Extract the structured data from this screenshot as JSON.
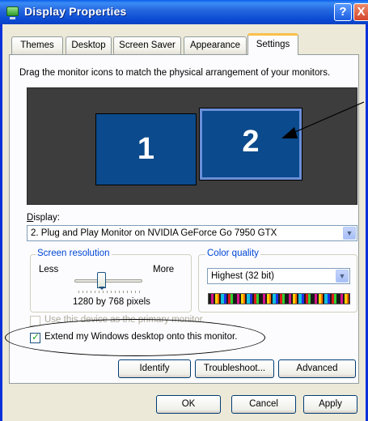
{
  "window": {
    "title": "Display Properties",
    "help": "?",
    "close": "X"
  },
  "tabs": [
    {
      "label": "Themes"
    },
    {
      "label": "Desktop"
    },
    {
      "label": "Screen Saver"
    },
    {
      "label": "Appearance"
    },
    {
      "label": "Settings"
    }
  ],
  "settings": {
    "instructions": "Drag the monitor icons to match the physical arrangement of your monitors.",
    "monitors": [
      {
        "label": "1"
      },
      {
        "label": "2"
      }
    ],
    "display_label": "Display:",
    "display_value": "2. Plug and Play Monitor on NVIDIA GeForce Go 7950 GTX",
    "resolution": {
      "group_title": "Screen resolution",
      "less": "Less",
      "more": "More",
      "value_text": "1280 by 768 pixels",
      "slider_fraction": 0.4
    },
    "color_quality": {
      "group_title": "Color quality",
      "value": "Highest (32 bit)"
    },
    "primary_checkbox": {
      "label": "Use this device as the primary monitor.",
      "checked": false,
      "disabled": true
    },
    "extend_checkbox": {
      "label": "Extend my Windows desktop onto this monitor.",
      "checked": true
    },
    "buttons": {
      "identify": "Identify",
      "troubleshoot": "Troubleshoot...",
      "advanced": "Advanced"
    }
  },
  "footer": {
    "ok": "OK",
    "cancel": "Cancel",
    "apply": "Apply"
  },
  "colors": {
    "titlebar": "#0a5ee8",
    "monitor_fill": "#0b4a8c",
    "accent_tab": "#fbc04a"
  }
}
